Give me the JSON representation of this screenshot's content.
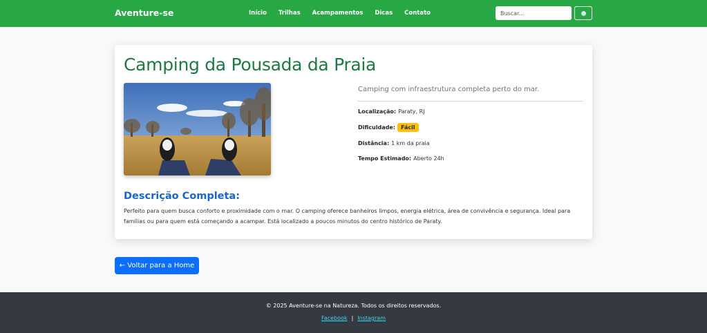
{
  "navbar": {
    "brand": "Aventure-se",
    "links": [
      "Início",
      "Trilhas",
      "Acampamentos",
      "Dicas",
      "Contato"
    ],
    "search_placeholder": "Buscar...",
    "search_icon": "search-icon",
    "color": "#28a745"
  },
  "card": {
    "title": "Camping da Pousada da Praia",
    "lead": "Camping com infraestrutura completa perto do mar.",
    "details": {
      "location_label": "Localização:",
      "location_value": "Paraty, RJ",
      "difficulty_label": "Dificuldade:",
      "difficulty_value": "Fácil",
      "distance_label": "Distância:",
      "distance_value": "1 km da praia",
      "time_label": "Tempo Estimado:",
      "time_value": "Aberto 24h"
    },
    "description_title": "Descrição Completa:",
    "description_text": "Perfeito para quem busca conforto e proximidade com o mar. O camping oferece banheiros limpos, energia elétrica, área de convivência e segurança. Ideal para famílias ou para quem está começando a acampar. Está localizado a poucos minutos do centro histórico de Paraty."
  },
  "back_button": "← Voltar para a Home",
  "footer": {
    "copyright": "© 2025 Aventure-se na Natureza. Todos os direitos reservados.",
    "links": [
      "Facebook",
      "Instagram"
    ],
    "separator": "|"
  },
  "colors": {
    "accent": "#28a745",
    "title": "#1e7a45",
    "primary": "#0d6efd",
    "badge": "#ffc107",
    "footer": "#343a40"
  }
}
